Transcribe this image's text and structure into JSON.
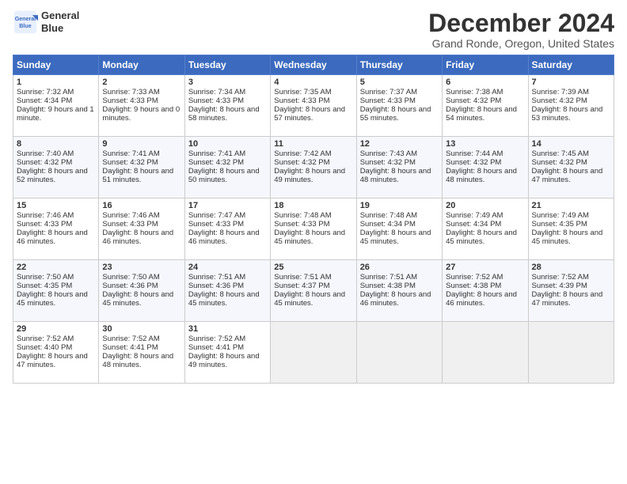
{
  "header": {
    "logo_line1": "General",
    "logo_line2": "Blue",
    "title": "December 2024",
    "location": "Grand Ronde, Oregon, United States"
  },
  "days_of_week": [
    "Sunday",
    "Monday",
    "Tuesday",
    "Wednesday",
    "Thursday",
    "Friday",
    "Saturday"
  ],
  "weeks": [
    [
      {
        "day": 1,
        "sunrise": "Sunrise: 7:32 AM",
        "sunset": "Sunset: 4:34 PM",
        "daylight": "Daylight: 9 hours and 1 minute."
      },
      {
        "day": 2,
        "sunrise": "Sunrise: 7:33 AM",
        "sunset": "Sunset: 4:33 PM",
        "daylight": "Daylight: 9 hours and 0 minutes."
      },
      {
        "day": 3,
        "sunrise": "Sunrise: 7:34 AM",
        "sunset": "Sunset: 4:33 PM",
        "daylight": "Daylight: 8 hours and 58 minutes."
      },
      {
        "day": 4,
        "sunrise": "Sunrise: 7:35 AM",
        "sunset": "Sunset: 4:33 PM",
        "daylight": "Daylight: 8 hours and 57 minutes."
      },
      {
        "day": 5,
        "sunrise": "Sunrise: 7:37 AM",
        "sunset": "Sunset: 4:33 PM",
        "daylight": "Daylight: 8 hours and 55 minutes."
      },
      {
        "day": 6,
        "sunrise": "Sunrise: 7:38 AM",
        "sunset": "Sunset: 4:32 PM",
        "daylight": "Daylight: 8 hours and 54 minutes."
      },
      {
        "day": 7,
        "sunrise": "Sunrise: 7:39 AM",
        "sunset": "Sunset: 4:32 PM",
        "daylight": "Daylight: 8 hours and 53 minutes."
      }
    ],
    [
      {
        "day": 8,
        "sunrise": "Sunrise: 7:40 AM",
        "sunset": "Sunset: 4:32 PM",
        "daylight": "Daylight: 8 hours and 52 minutes."
      },
      {
        "day": 9,
        "sunrise": "Sunrise: 7:41 AM",
        "sunset": "Sunset: 4:32 PM",
        "daylight": "Daylight: 8 hours and 51 minutes."
      },
      {
        "day": 10,
        "sunrise": "Sunrise: 7:41 AM",
        "sunset": "Sunset: 4:32 PM",
        "daylight": "Daylight: 8 hours and 50 minutes."
      },
      {
        "day": 11,
        "sunrise": "Sunrise: 7:42 AM",
        "sunset": "Sunset: 4:32 PM",
        "daylight": "Daylight: 8 hours and 49 minutes."
      },
      {
        "day": 12,
        "sunrise": "Sunrise: 7:43 AM",
        "sunset": "Sunset: 4:32 PM",
        "daylight": "Daylight: 8 hours and 48 minutes."
      },
      {
        "day": 13,
        "sunrise": "Sunrise: 7:44 AM",
        "sunset": "Sunset: 4:32 PM",
        "daylight": "Daylight: 8 hours and 48 minutes."
      },
      {
        "day": 14,
        "sunrise": "Sunrise: 7:45 AM",
        "sunset": "Sunset: 4:32 PM",
        "daylight": "Daylight: 8 hours and 47 minutes."
      }
    ],
    [
      {
        "day": 15,
        "sunrise": "Sunrise: 7:46 AM",
        "sunset": "Sunset: 4:33 PM",
        "daylight": "Daylight: 8 hours and 46 minutes."
      },
      {
        "day": 16,
        "sunrise": "Sunrise: 7:46 AM",
        "sunset": "Sunset: 4:33 PM",
        "daylight": "Daylight: 8 hours and 46 minutes."
      },
      {
        "day": 17,
        "sunrise": "Sunrise: 7:47 AM",
        "sunset": "Sunset: 4:33 PM",
        "daylight": "Daylight: 8 hours and 46 minutes."
      },
      {
        "day": 18,
        "sunrise": "Sunrise: 7:48 AM",
        "sunset": "Sunset: 4:33 PM",
        "daylight": "Daylight: 8 hours and 45 minutes."
      },
      {
        "day": 19,
        "sunrise": "Sunrise: 7:48 AM",
        "sunset": "Sunset: 4:34 PM",
        "daylight": "Daylight: 8 hours and 45 minutes."
      },
      {
        "day": 20,
        "sunrise": "Sunrise: 7:49 AM",
        "sunset": "Sunset: 4:34 PM",
        "daylight": "Daylight: 8 hours and 45 minutes."
      },
      {
        "day": 21,
        "sunrise": "Sunrise: 7:49 AM",
        "sunset": "Sunset: 4:35 PM",
        "daylight": "Daylight: 8 hours and 45 minutes."
      }
    ],
    [
      {
        "day": 22,
        "sunrise": "Sunrise: 7:50 AM",
        "sunset": "Sunset: 4:35 PM",
        "daylight": "Daylight: 8 hours and 45 minutes."
      },
      {
        "day": 23,
        "sunrise": "Sunrise: 7:50 AM",
        "sunset": "Sunset: 4:36 PM",
        "daylight": "Daylight: 8 hours and 45 minutes."
      },
      {
        "day": 24,
        "sunrise": "Sunrise: 7:51 AM",
        "sunset": "Sunset: 4:36 PM",
        "daylight": "Daylight: 8 hours and 45 minutes."
      },
      {
        "day": 25,
        "sunrise": "Sunrise: 7:51 AM",
        "sunset": "Sunset: 4:37 PM",
        "daylight": "Daylight: 8 hours and 45 minutes."
      },
      {
        "day": 26,
        "sunrise": "Sunrise: 7:51 AM",
        "sunset": "Sunset: 4:38 PM",
        "daylight": "Daylight: 8 hours and 46 minutes."
      },
      {
        "day": 27,
        "sunrise": "Sunrise: 7:52 AM",
        "sunset": "Sunset: 4:38 PM",
        "daylight": "Daylight: 8 hours and 46 minutes."
      },
      {
        "day": 28,
        "sunrise": "Sunrise: 7:52 AM",
        "sunset": "Sunset: 4:39 PM",
        "daylight": "Daylight: 8 hours and 47 minutes."
      }
    ],
    [
      {
        "day": 29,
        "sunrise": "Sunrise: 7:52 AM",
        "sunset": "Sunset: 4:40 PM",
        "daylight": "Daylight: 8 hours and 47 minutes."
      },
      {
        "day": 30,
        "sunrise": "Sunrise: 7:52 AM",
        "sunset": "Sunset: 4:41 PM",
        "daylight": "Daylight: 8 hours and 48 minutes."
      },
      {
        "day": 31,
        "sunrise": "Sunrise: 7:52 AM",
        "sunset": "Sunset: 4:41 PM",
        "daylight": "Daylight: 8 hours and 49 minutes."
      },
      null,
      null,
      null,
      null
    ]
  ]
}
